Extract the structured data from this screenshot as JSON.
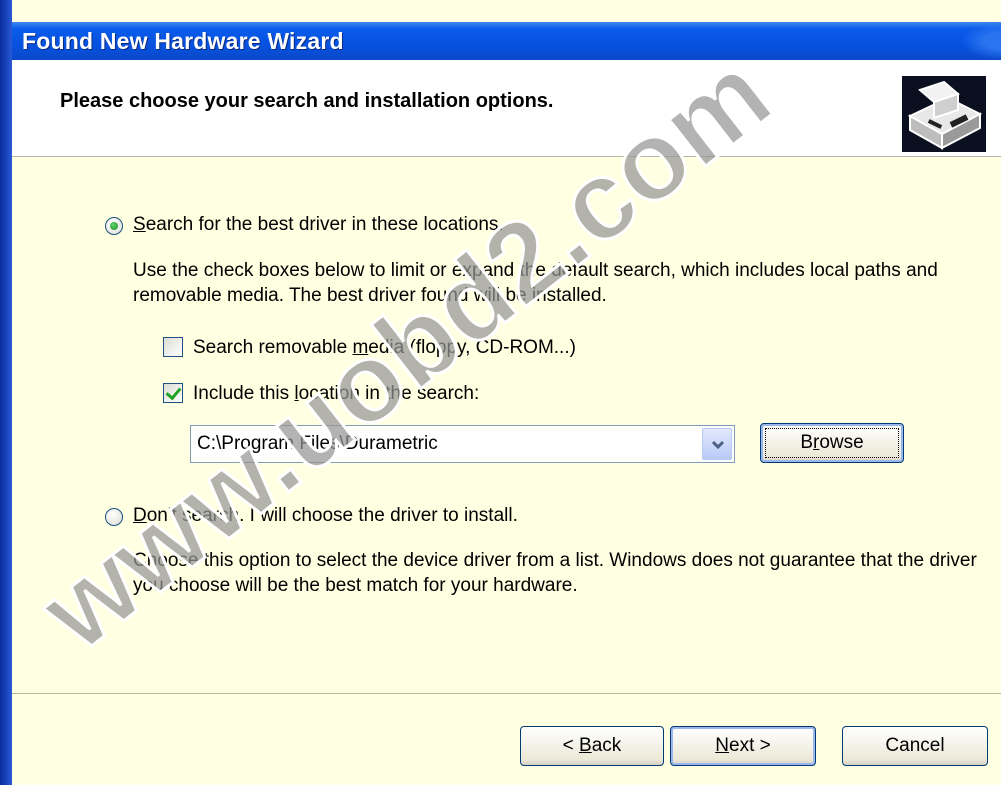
{
  "window": {
    "title": "Found New Hardware Wizard",
    "colors": {
      "titlebar": "#0752e0",
      "body": "#ffffe1",
      "header": "#ffffff"
    }
  },
  "header": {
    "title": "Please choose your search and installation options.",
    "icon": "hardware-install-icon"
  },
  "options": {
    "search": {
      "prefix": "",
      "underline_char": "S",
      "rest": "earch for the best driver in these locations.",
      "selected": true,
      "description": "Use the check boxes below to limit or expand the default search, which includes local paths and removable media. The best driver found will be installed.",
      "removable_media": {
        "label_a": "Search removable ",
        "label_u": "m",
        "label_b": "edia (floppy, CD-ROM...)",
        "checked": false
      },
      "include_location": {
        "label_a": "Include this ",
        "label_u": "l",
        "label_b": "ocation in the search:",
        "checked": true
      },
      "location_value": "C:\\Program Files\\Durametric",
      "browse_u": "r",
      "browse_a": "B",
      "browse_b": "owse"
    },
    "dont_search": {
      "underline_char": "D",
      "rest": "on't search. I will choose the driver to install.",
      "selected": false,
      "description": "Choose this option to select the device driver from a list.  Windows does not guarantee that the driver you choose will be the best match for your hardware."
    }
  },
  "footer": {
    "back_a": "< ",
    "back_u": "B",
    "back_b": "ack",
    "next_u": "N",
    "next_b": "ext >",
    "cancel": "Cancel"
  },
  "watermark": "www.uobd2.com"
}
